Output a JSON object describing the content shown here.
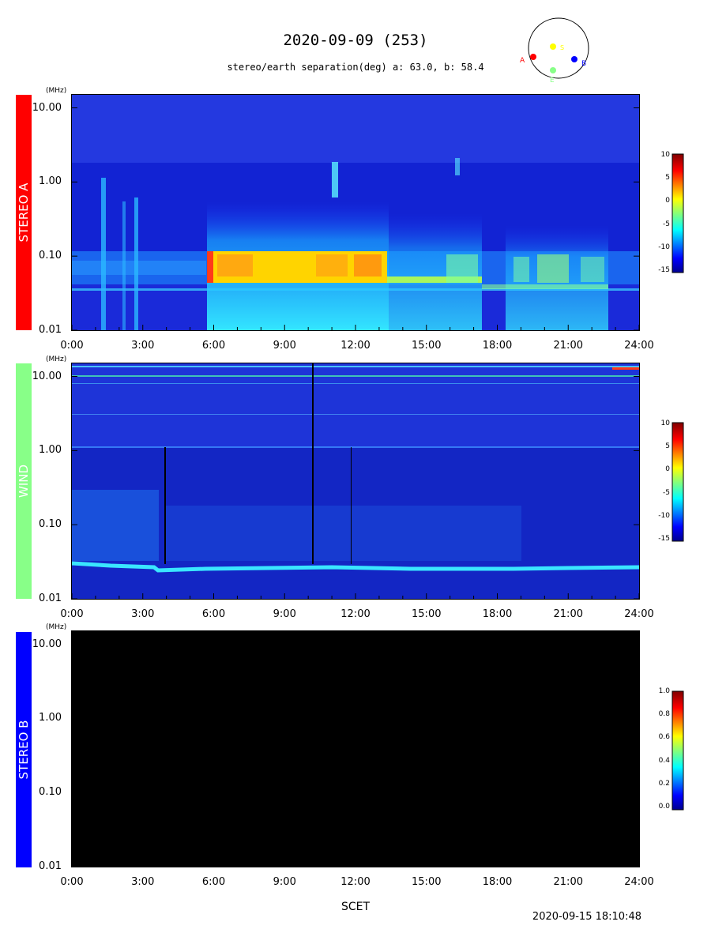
{
  "title": "2020-09-09 (253)",
  "subtitle": "stereo/earth separation(deg) a:  63.0, b:  58.4",
  "orbit_labels": {
    "A": "A",
    "S": "S",
    "B": "B",
    "E": "E"
  },
  "colors": {
    "stereo_a": "#ff0000",
    "wind": "#88ff88",
    "stereo_b": "#0000ff",
    "sun": "#ffff00",
    "earth": "#88ff88"
  },
  "xlabel": "SCET",
  "timestamp": "2020-09-15 18:10:48",
  "chart_data": [
    {
      "type": "heatmap",
      "panel": "STEREO A",
      "y_unit": "(MHz)",
      "x_ticks": [
        "0:00",
        "3:00",
        "6:00",
        "9:00",
        "12:00",
        "15:00",
        "18:00",
        "21:00",
        "24:00"
      ],
      "y_ticks": [
        "10.00",
        "1.00",
        "0.10",
        "0.01"
      ],
      "y_scale": "log",
      "ylim": [
        0.01,
        15
      ],
      "colorbar": {
        "ticks": [
          "10",
          "5",
          "0",
          "-5",
          "-10",
          "-15"
        ],
        "range": [
          -15,
          10
        ]
      }
    },
    {
      "type": "heatmap",
      "panel": "WIND",
      "y_unit": "(MHz)",
      "x_ticks": [
        "0:00",
        "3:00",
        "6:00",
        "9:00",
        "12:00",
        "15:00",
        "18:00",
        "21:00",
        "24:00"
      ],
      "y_ticks": [
        "10.00",
        "1.00",
        "0.10",
        "0.01"
      ],
      "y_scale": "log",
      "ylim": [
        0.01,
        15
      ],
      "colorbar": {
        "ticks": [
          "10",
          "5",
          "0",
          "-5",
          "-10",
          "-15"
        ],
        "range": [
          -15,
          10
        ]
      }
    },
    {
      "type": "heatmap",
      "panel": "STEREO B",
      "y_unit": "(MHz)",
      "x_ticks": [
        "0:00",
        "3:00",
        "6:00",
        "9:00",
        "12:00",
        "15:00",
        "18:00",
        "21:00",
        "24:00"
      ],
      "y_ticks": [
        "10.00",
        "1.00",
        "0.10",
        "0.01"
      ],
      "y_scale": "log",
      "ylim": [
        0.01,
        15
      ],
      "colorbar": {
        "ticks": [
          "1.0",
          "0.8",
          "0.6",
          "0.4",
          "0.2",
          "0.0"
        ],
        "range": [
          0,
          1
        ]
      }
    }
  ]
}
